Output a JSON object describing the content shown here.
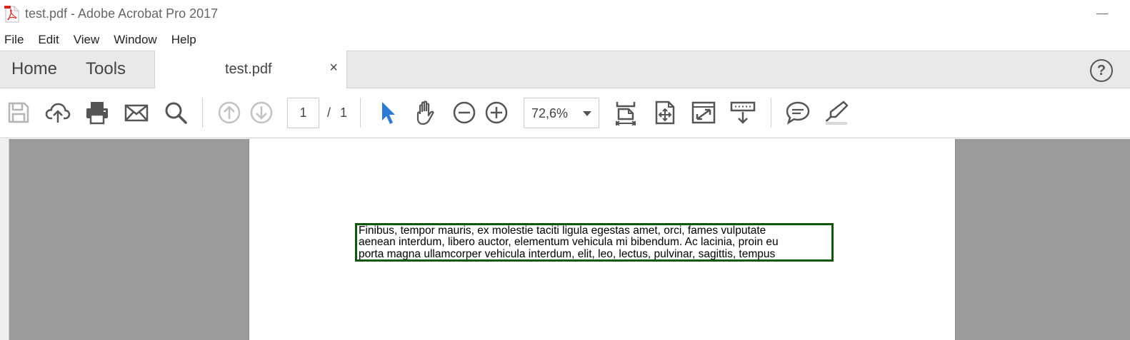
{
  "window": {
    "title": "test.pdf - Adobe Acrobat Pro 2017"
  },
  "menu": [
    "File",
    "Edit",
    "View",
    "Window",
    "Help"
  ],
  "tabs": {
    "home": "Home",
    "tools": "Tools",
    "document": "test.pdf",
    "close_glyph": "×",
    "help_glyph": "?"
  },
  "toolbar": {
    "icons": [
      "save-icon",
      "cloud-upload-icon",
      "print-icon",
      "email-icon",
      "search-icon",
      "prev-page-icon",
      "next-page-icon",
      "select-cursor-icon",
      "hand-icon",
      "zoom-out-icon",
      "zoom-in-icon",
      "fit-page-icon",
      "scroll-mode-icon",
      "full-screen-icon",
      "page-display-icon",
      "comment-icon",
      "highlight-icon"
    ],
    "page_current": "1",
    "page_separator": "/",
    "page_total": "1",
    "zoom": "72,6%"
  },
  "colors": {
    "select_tool_active": "#2d7bd6",
    "text_box_border": "#0a5a0a",
    "workspace_gray": "#9b9b9b"
  },
  "document": {
    "lines": [
      "Finibus, tempor mauris, ex molestie taciti ligula egestas amet, orci, fames vulputate",
      "aenean interdum, libero auctor, elementum vehicula mi bibendum. Ac lacinia, proin eu",
      "porta magna ullamcorper vehicula interdum, elit, leo, lectus, pulvinar, sagittis, tempus"
    ]
  }
}
